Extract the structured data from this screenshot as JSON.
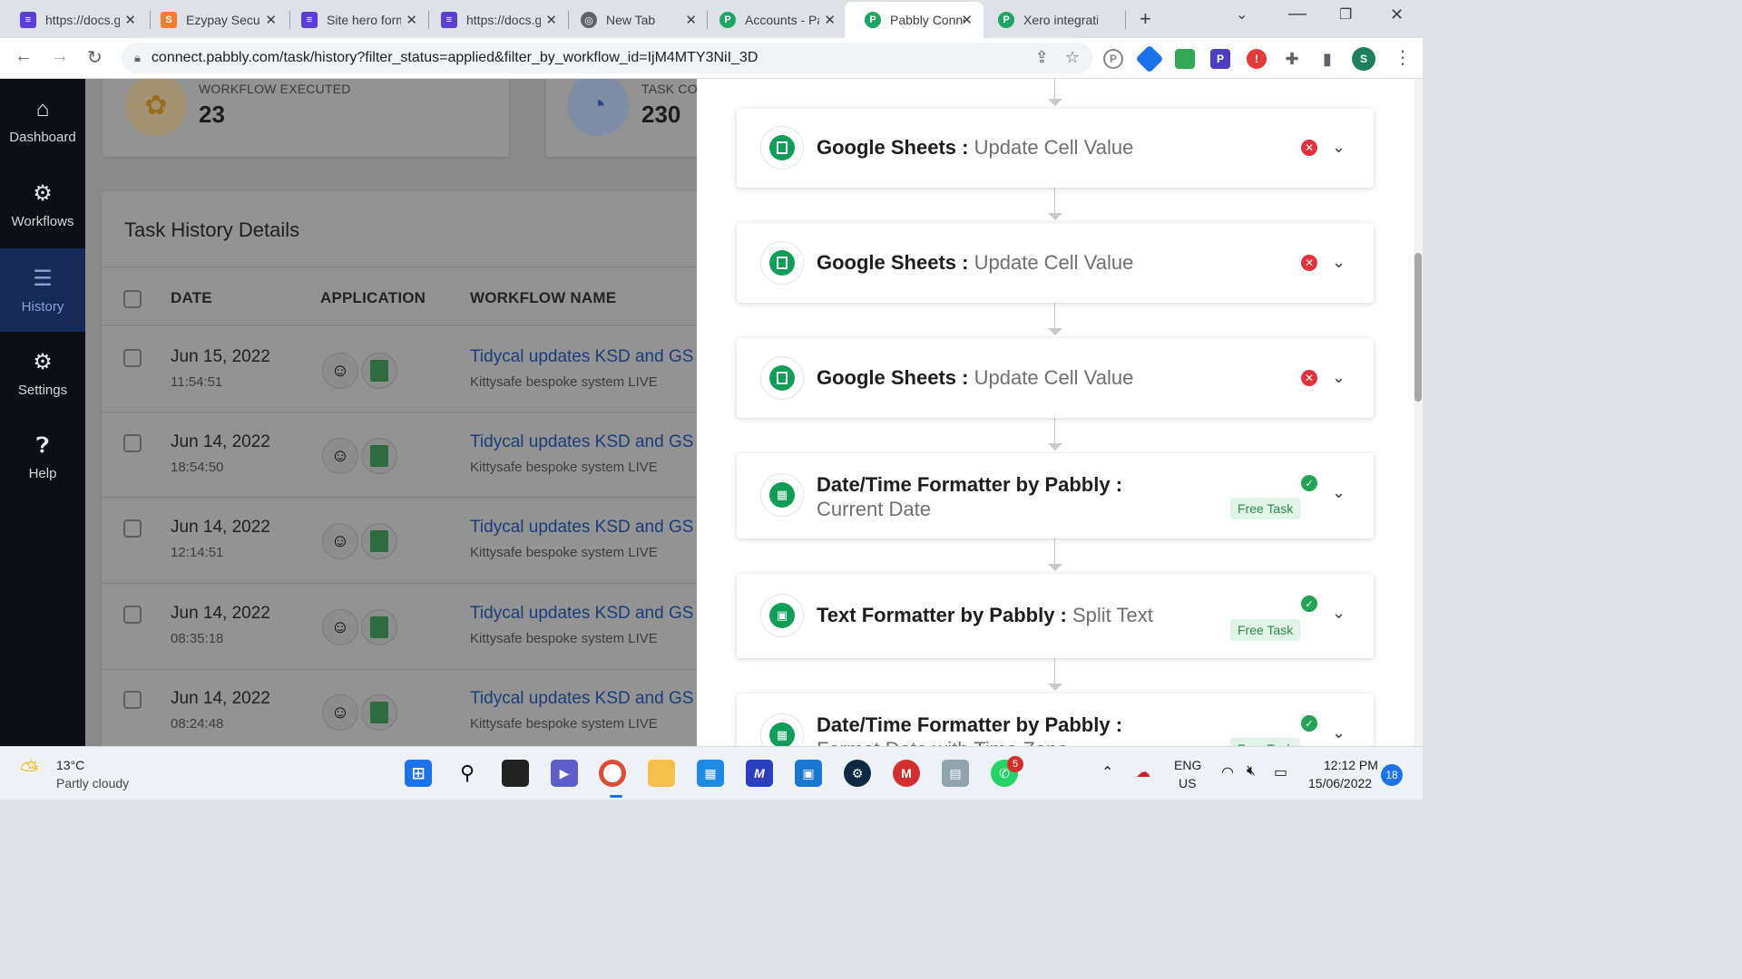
{
  "browser": {
    "tabs": [
      {
        "title": "https://docs.google.com",
        "color": "#5b3fd1",
        "glyph": "≡"
      },
      {
        "title": "Ezypay Security",
        "color": "#f57c2a",
        "glyph": "S"
      },
      {
        "title": "Site hero form",
        "color": "#5b3fd1",
        "glyph": "≡"
      },
      {
        "title": "https://docs.google.com",
        "color": "#5b3fd1",
        "glyph": "≡"
      },
      {
        "title": "New Tab",
        "color": "#5f6368",
        "glyph": "◎"
      },
      {
        "title": "Accounts - Pabbly",
        "color": "#1fa463",
        "glyph": "P"
      },
      {
        "title": "Pabbly Connect",
        "color": "#1fa463",
        "glyph": "P"
      },
      {
        "title": "Xero integration",
        "color": "#1fa463",
        "glyph": "P"
      }
    ],
    "url": "connect.pabbly.com/task/history?filter_status=applied&filter_by_workflow_id=IjM4MTY3NiI_3D",
    "profile_initial": "S"
  },
  "sidebar": {
    "items": [
      {
        "label": "Dashboard",
        "icon": "home-icon"
      },
      {
        "label": "Workflows",
        "icon": "workflow-icon"
      },
      {
        "label": "History",
        "icon": "history-icon"
      },
      {
        "label": "Settings",
        "icon": "gear-icon"
      },
      {
        "label": "Help",
        "icon": "help-icon"
      }
    ]
  },
  "stats": {
    "executed_label": "WORKFLOW EXECUTED",
    "executed_value": "23",
    "task_label": "TASK CO",
    "task_value": "230"
  },
  "task_history": {
    "title": "Task History Details",
    "columns": [
      "DATE",
      "APPLICATION",
      "WORKFLOW NAME"
    ],
    "rows": [
      {
        "date": "Jun 15, 2022",
        "time": "11:54:51",
        "workflow": "Tidycal updates KSD and GS s",
        "sub": "Kittysafe bespoke system LIVE"
      },
      {
        "date": "Jun 14, 2022",
        "time": "18:54:50",
        "workflow": "Tidycal updates KSD and GS s",
        "sub": "Kittysafe bespoke system LIVE"
      },
      {
        "date": "Jun 14, 2022",
        "time": "12:14:51",
        "workflow": "Tidycal updates KSD and GS s",
        "sub": "Kittysafe bespoke system LIVE"
      },
      {
        "date": "Jun 14, 2022",
        "time": "08:35:18",
        "workflow": "Tidycal updates KSD and GS s",
        "sub": "Kittysafe bespoke system LIVE"
      },
      {
        "date": "Jun 14, 2022",
        "time": "08:24:48",
        "workflow": "Tidycal updates KSD and GS s",
        "sub": "Kittysafe bespoke system LIVE"
      }
    ]
  },
  "steps": [
    {
      "app": "Google Sheets :",
      "action": "Update Cell Value",
      "status": "error",
      "icon": "sheets-icon"
    },
    {
      "app": "Google Sheets :",
      "action": "Update Cell Value",
      "status": "error",
      "icon": "sheets-icon"
    },
    {
      "app": "Google Sheets :",
      "action": "Update Cell Value",
      "status": "error",
      "icon": "sheets-icon"
    },
    {
      "app": "Date/Time Formatter by Pabbly :",
      "action": "Current Date",
      "status": "success",
      "badge": "Free Task",
      "icon": "calendar-icon"
    },
    {
      "app": "Text Formatter by Pabbly :",
      "action": "Split Text",
      "status": "success",
      "badge": "Free Task",
      "icon": "text-formatter-icon"
    },
    {
      "app": "Date/Time Formatter by Pabbly :",
      "action": "Format Date with Time Zone",
      "status": "success",
      "badge": "Free Task",
      "icon": "calendar-icon"
    }
  ],
  "taskbar": {
    "weather_temp": "13°C",
    "weather_desc": "Partly cloudy",
    "lang_top": "ENG",
    "lang_bottom": "US",
    "time": "12:12 PM",
    "date": "15/06/2022",
    "notifications": "18",
    "whatsapp_badge": "5"
  }
}
